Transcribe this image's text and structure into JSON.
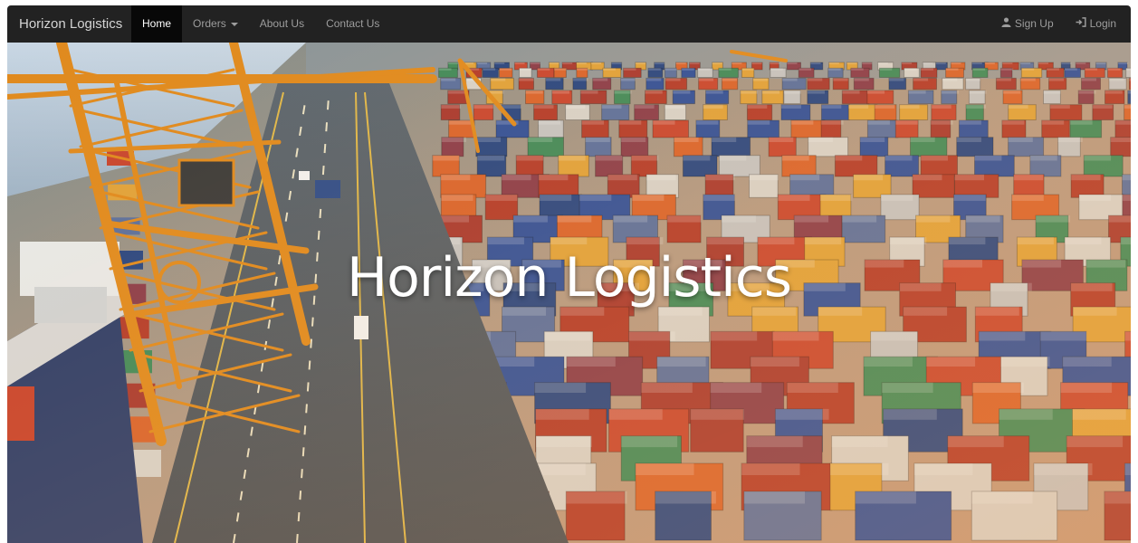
{
  "navbar": {
    "brand": "Horizon Logistics",
    "items": [
      {
        "label": "Home",
        "active": true
      },
      {
        "label": "Orders",
        "dropdown": true
      },
      {
        "label": "About Us"
      },
      {
        "label": "Contact Us"
      }
    ],
    "right": [
      {
        "label": "Sign Up",
        "icon": "user-icon"
      },
      {
        "label": "Login",
        "icon": "login-icon"
      }
    ]
  },
  "hero": {
    "title": "Horizon Logistics",
    "image": "container-port-aerial-photo"
  },
  "colors": {
    "navbar_bg": "#222222",
    "nav_active_bg": "#080808",
    "nav_text": "#9d9d9d",
    "crane": "#e08a1e"
  }
}
